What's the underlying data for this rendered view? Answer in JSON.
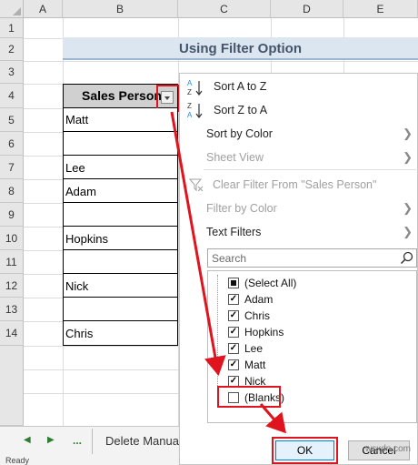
{
  "columns": [
    "A",
    "B",
    "C",
    "D",
    "E"
  ],
  "rows": [
    "1",
    "2",
    "3",
    "4",
    "5",
    "6",
    "7",
    "8",
    "9",
    "10",
    "11",
    "12",
    "13",
    "14"
  ],
  "sheet_title": "Using Filter Option",
  "table": {
    "header": "Sales Person",
    "cells": [
      "Matt",
      "",
      "Lee",
      "Adam",
      "",
      "Hopkins",
      "",
      "Nick",
      "",
      "Chris"
    ]
  },
  "menu": {
    "sort_az": "Sort A to Z",
    "sort_za": "Sort Z to A",
    "sort_by_color": "Sort by Color",
    "sheet_view": "Sheet View",
    "clear_filter": "Clear Filter From \"Sales Person\"",
    "filter_by_color": "Filter by Color",
    "text_filters": "Text Filters",
    "search_placeholder": "Search",
    "items": [
      {
        "label": "(Select All)",
        "state": "partial"
      },
      {
        "label": "Adam",
        "state": "checked"
      },
      {
        "label": "Chris",
        "state": "checked"
      },
      {
        "label": "Hopkins",
        "state": "checked"
      },
      {
        "label": "Lee",
        "state": "checked"
      },
      {
        "label": "Matt",
        "state": "checked"
      },
      {
        "label": "Nick",
        "state": "checked"
      },
      {
        "label": "(Blanks)",
        "state": "unchecked"
      }
    ],
    "ok": "OK",
    "cancel": "Cancel"
  },
  "tabs": {
    "ellipsis": "...",
    "sheet_tab": "Delete Manua"
  },
  "status": "Ready",
  "watermark": "wsxdn.com",
  "colors": {
    "highlight": "#e0141e",
    "title_bg": "#dce6f0",
    "header_bg": "#d0d0d0"
  }
}
